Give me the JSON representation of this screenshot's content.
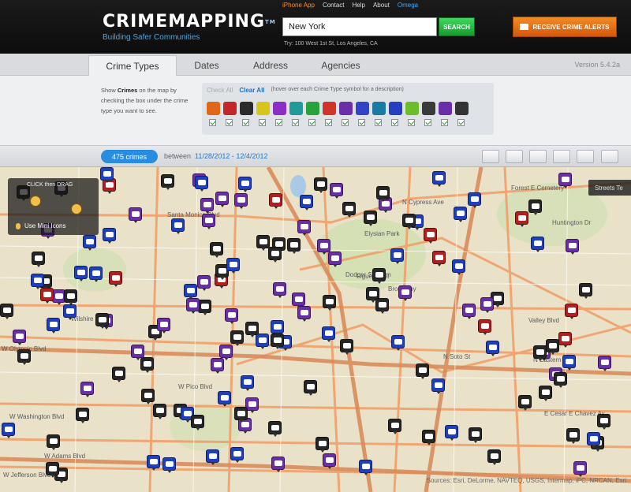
{
  "header": {
    "logo_text": "CRIMEMAPPING",
    "logo_tm": "TM",
    "logo_tagline": "Building Safer Communities",
    "top_links": [
      "iPhone App",
      "Contact",
      "Help",
      "About",
      "Omega"
    ],
    "search_value": "New York",
    "search_button": "SEARCH",
    "try_text": "Try: 100 West 1st St, Los Angeles, CA",
    "alerts_button": "RECEIVE CRIME ALERTS"
  },
  "tabs": [
    {
      "label": "Crime Types",
      "active": true
    },
    {
      "label": "Dates",
      "active": false
    },
    {
      "label": "Address",
      "active": false
    },
    {
      "label": "Agencies",
      "active": false
    }
  ],
  "version": "Version 5.4.2a",
  "filter": {
    "desc_pre": "Show",
    "desc_bold": "Crimes",
    "desc_post": "on the map by checking the box under the crime type you want to see.",
    "check_all": "Check All",
    "clear_all": "Clear All",
    "hint": "(hover over each Crime Type symbol for a description)",
    "crime_type_icons": [
      {
        "name": "arson-icon",
        "color": "#e0661a"
      },
      {
        "name": "assault-icon",
        "color": "#c4262a"
      },
      {
        "name": "burglary-icon",
        "color": "#2b2b2b"
      },
      {
        "name": "disturbing-peace-icon",
        "color": "#d8c51c"
      },
      {
        "name": "drugs-icon",
        "color": "#8a2ec4"
      },
      {
        "name": "dui-icon",
        "color": "#1f9c9a"
      },
      {
        "name": "fraud-icon",
        "color": "#27a33a"
      },
      {
        "name": "homicide-icon",
        "color": "#d0352c"
      },
      {
        "name": "motor-vehicle-theft-icon",
        "color": "#6b2ea8"
      },
      {
        "name": "robbery-icon",
        "color": "#3344c4"
      },
      {
        "name": "sex-crimes-icon",
        "color": "#1a7aa3"
      },
      {
        "name": "theft-icon",
        "color": "#2240c0"
      },
      {
        "name": "theft-from-vehicle-icon",
        "color": "#6cbd2a"
      },
      {
        "name": "vandalism-icon",
        "color": "#3a3a3a"
      },
      {
        "name": "weapons-icon",
        "color": "#6a2ea8"
      },
      {
        "name": "other-icon",
        "color": "#333333"
      }
    ]
  },
  "status": {
    "count": "475 crimes",
    "between_label": "between",
    "date_range": "11/28/2012 - 12/4/2012"
  },
  "map": {
    "mini_drag": "CLICK then DRAG",
    "mini_icons": "Use Mini Icons",
    "layer_button": "Streets  Te",
    "sources": "Sources: Esri, DeLorme, NAVTEQ, USGS, Intermap, iPC, NRCAN, Esri",
    "labels": [
      "Santa Monica Blvd",
      "Wilshire Blvd",
      "W Olympic Blvd",
      "W Pico Blvd",
      "W Washington Blvd",
      "W Adams Blvd",
      "W Jefferson Blvd",
      "N Cypress Ave",
      "Figueroa St",
      "Valley Blvd",
      "E Cesar E Chavez Av",
      "Huntington Dr",
      "Forest E Cemetery",
      "Dodger Stadium",
      "Elysian Park",
      "Broadway",
      "N Eastern Ave",
      "N Soto St"
    ]
  }
}
